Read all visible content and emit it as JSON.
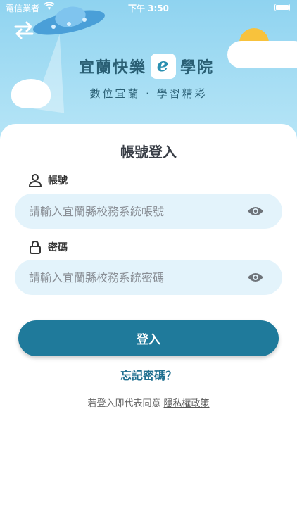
{
  "status": {
    "carrier": "電信業者",
    "time": "下午 3:50"
  },
  "header": {
    "title_left": "宜蘭快樂",
    "title_logo": "e",
    "title_right": "學院",
    "subtitle": "數位宜蘭 · 學習精彩"
  },
  "login": {
    "heading": "帳號登入",
    "account_label": "帳號",
    "account_placeholder": "請輸入宜蘭縣校務系統帳號",
    "password_label": "密碼",
    "password_placeholder": "請輸入宜蘭縣校務系統密碼",
    "submit_label": "登入",
    "forgot_label": "忘記密碼？",
    "agree_text": "若登入即代表同意",
    "privacy_link": "隱私權政策"
  },
  "colors": {
    "accent": "#1f7a9b",
    "field_bg": "#e3f3fb",
    "sky": "#8fd3f0"
  }
}
